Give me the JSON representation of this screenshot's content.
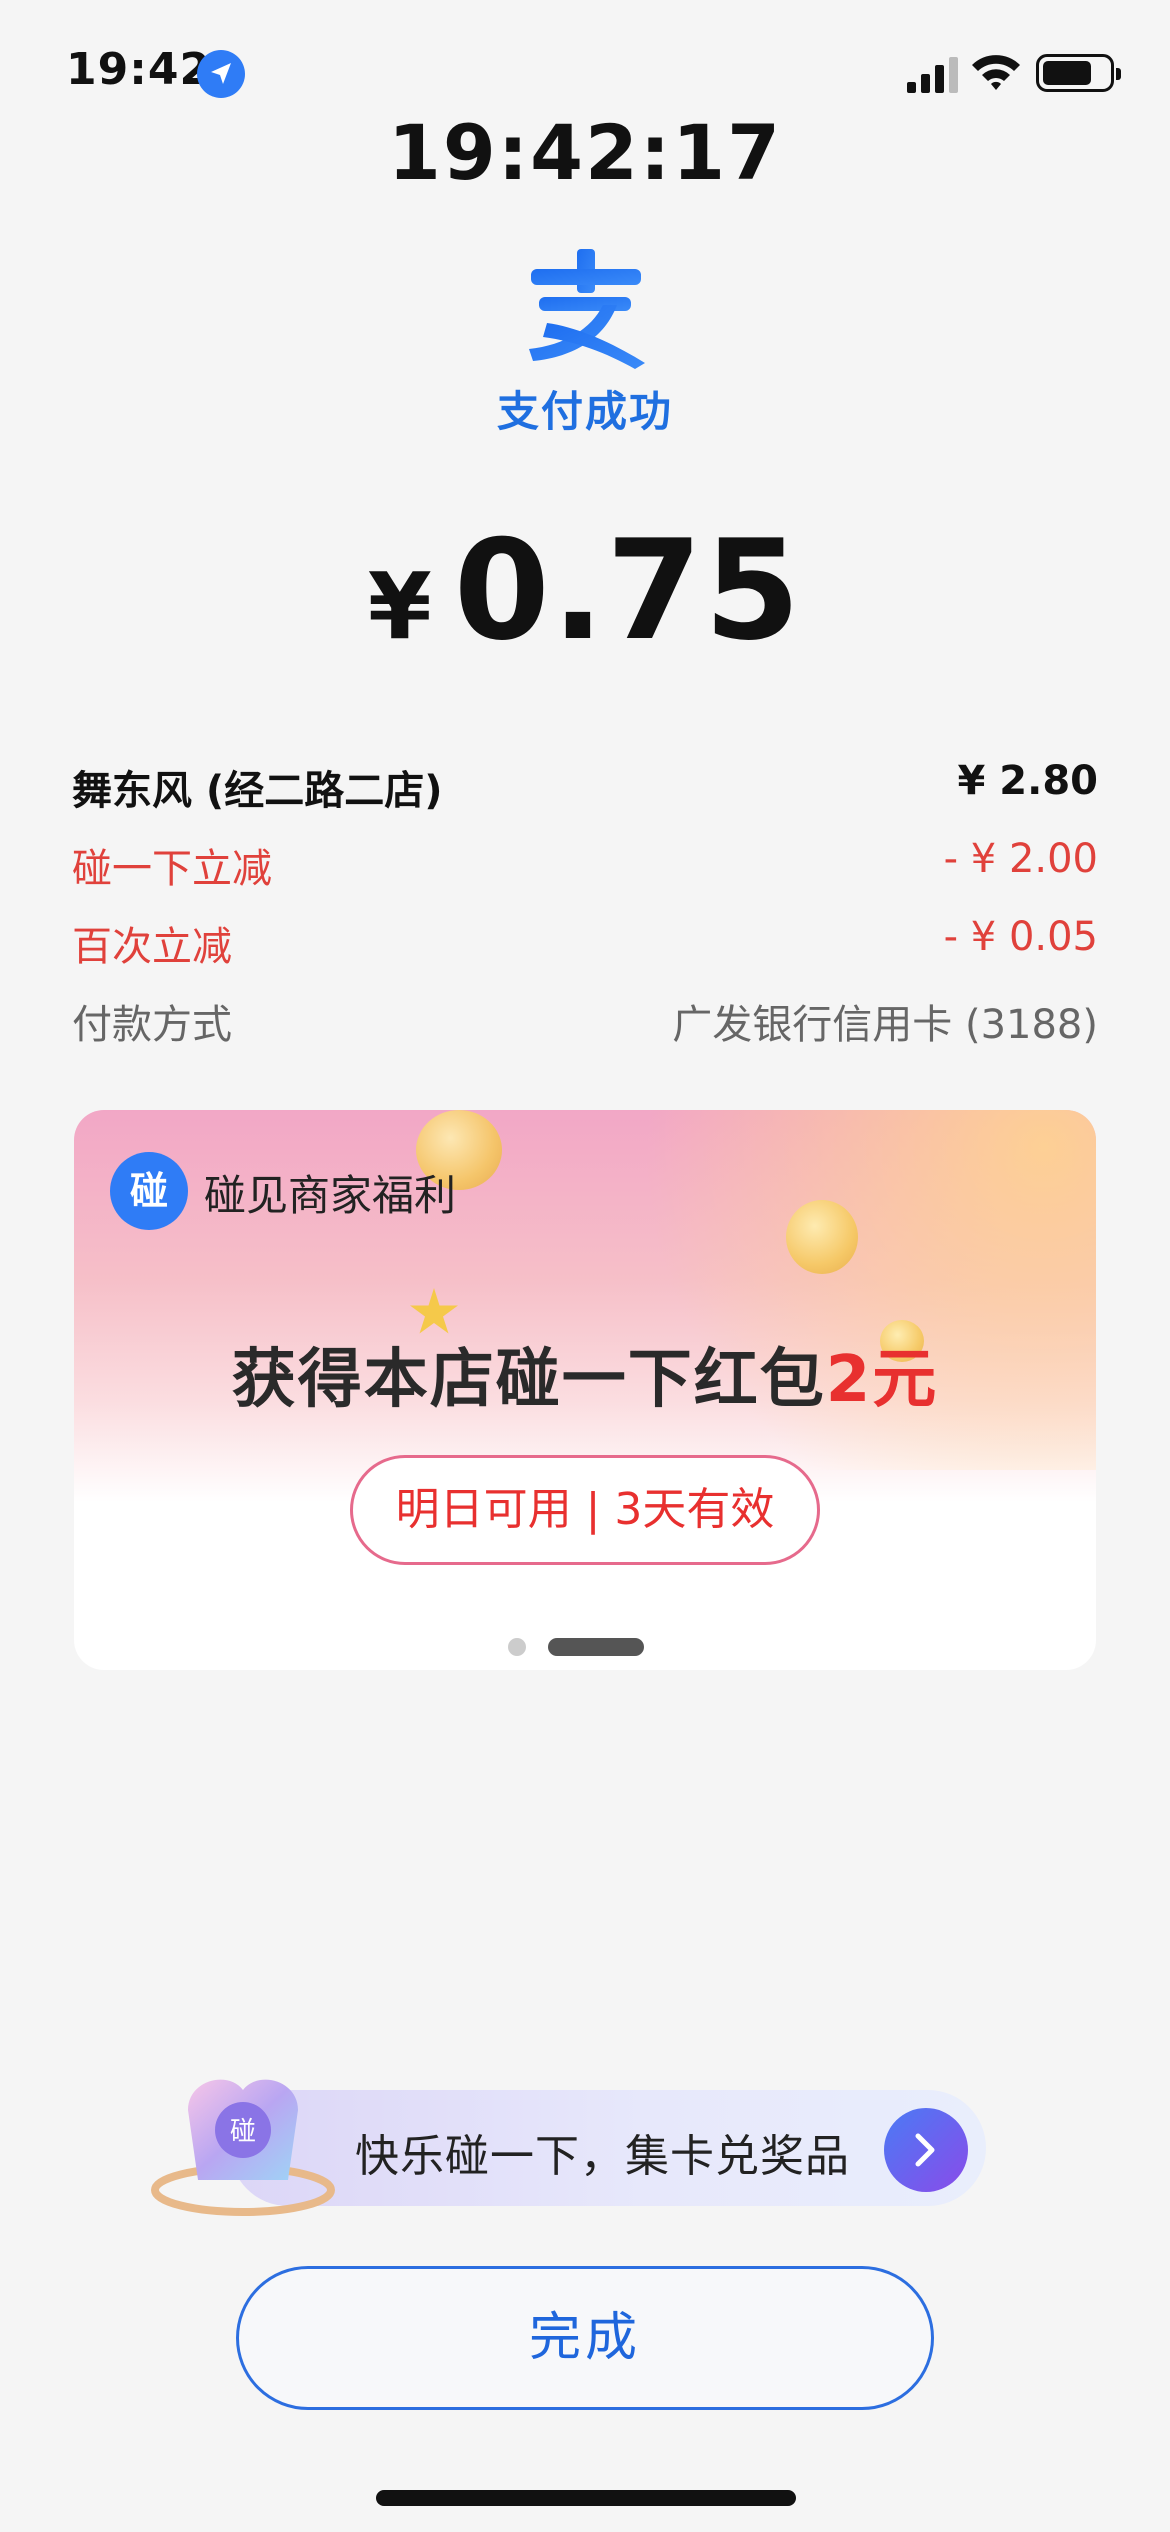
{
  "status_bar": {
    "time": "19:42",
    "icons": [
      "location-arrow-icon",
      "cellular-signal-icon",
      "wifi-icon",
      "battery-icon"
    ]
  },
  "clock": "19:42:17",
  "header": {
    "logo_icon": "alipay-logo-icon",
    "status_text": "支付成功",
    "accent_color": "#1f6fe0"
  },
  "amount": {
    "currency": "¥",
    "value": "0.75"
  },
  "details": {
    "merchant_name": "舞东风 (经二路二店)",
    "merchant_price": "¥ 2.80",
    "discount1_label": "碰一下立减",
    "discount1_value": "- ¥ 2.00",
    "discount2_label": "百次立减",
    "discount2_value": "- ¥ 0.05",
    "method_label": "付款方式",
    "method_value": "广发银行信用卡 (3188)",
    "discount_color": "#e0413b"
  },
  "promo": {
    "badge_char": "碰",
    "tag": "碰见商家福利",
    "headline_prefix": "获得本店碰一下红包",
    "headline_amount": "2元",
    "pill_text": "明日可用 | 3天有效",
    "carousel": {
      "count": 2,
      "active_index": 1
    }
  },
  "banner": {
    "text": "快乐碰一下，集卡兑奖品",
    "arrow_icon": "chevron-right-icon"
  },
  "done_button": "完成"
}
